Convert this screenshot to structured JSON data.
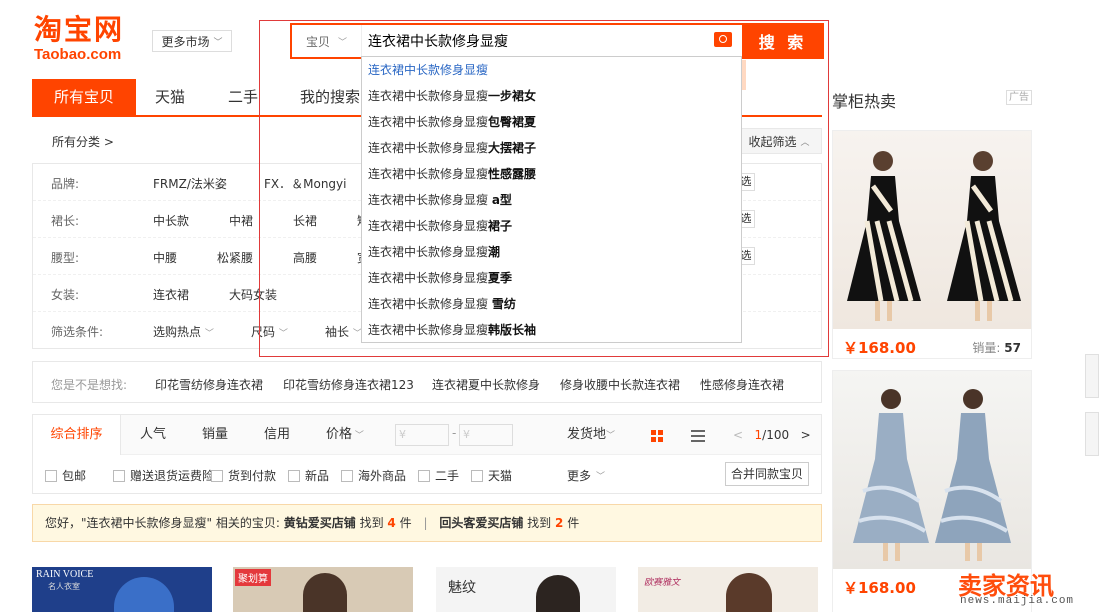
{
  "header": {
    "logo_cn": "淘宝网",
    "logo_en": "Taobao.com",
    "market": "更多市场"
  },
  "search": {
    "type": "宝贝",
    "value": "连衣裙中长款修身显瘦",
    "button": "搜 索"
  },
  "suggestions": [
    {
      "base": "连衣裙中长款修身显瘦",
      "extra": ""
    },
    {
      "base": "连衣裙中长款修身显瘦",
      "extra": "一步裙女"
    },
    {
      "base": "连衣裙中长款修身显瘦",
      "extra": "包臀裙夏"
    },
    {
      "base": "连衣裙中长款修身显瘦",
      "extra": "大摆裙子"
    },
    {
      "base": "连衣裙中长款修身显瘦",
      "extra": "性感露腰"
    },
    {
      "base": "连衣裙中长款修身显瘦 ",
      "extra": "a型"
    },
    {
      "base": "连衣裙中长款修身显瘦",
      "extra": "裙子"
    },
    {
      "base": "连衣裙中长款修身显瘦",
      "extra": "潮"
    },
    {
      "base": "连衣裙中长款修身显瘦",
      "extra": "夏季"
    },
    {
      "base": "连衣裙中长款修身显瘦 ",
      "extra": "雪纺"
    },
    {
      "base": "连衣裙中长款修身显瘦",
      "extra": "韩版长袖"
    }
  ],
  "tabs": [
    "所有宝贝",
    "天猫",
    "二手",
    "我的搜索"
  ],
  "filters": {
    "crumb": "所有分类 >",
    "collapse": "收起筛选",
    "multi": "选",
    "rows": [
      {
        "label": "品牌:",
        "options": [
          "FRMZ/法米姿",
          "FX．＆Mongyi"
        ]
      },
      {
        "label": "裙长:",
        "options": [
          "中长款",
          "中裙",
          "长裙",
          "短"
        ]
      },
      {
        "label": "腰型:",
        "options": [
          "中腰",
          "松紧腰",
          "高腰",
          "宽"
        ]
      },
      {
        "label": "女装:",
        "options": [
          "连衣裙",
          "大码女装"
        ]
      },
      {
        "label": "筛选条件:",
        "options": [
          "选购热点",
          "尺码",
          "袖长"
        ]
      }
    ]
  },
  "suggest_row": {
    "label": "您是不是想找:",
    "items": [
      "印花雪纺修身连衣裙",
      "印花雪纺修身连衣裙123",
      "连衣裙夏中长款修身",
      "修身收腰中长款连衣裙",
      "性感修身连衣裙"
    ]
  },
  "sort": {
    "items": [
      "综合排序",
      "人气",
      "销量",
      "信用",
      "价格"
    ],
    "price_from": "¥",
    "price_to": "¥",
    "ship_from": "发货地",
    "page_current": "1",
    "page_total": "/100"
  },
  "checks": [
    "包邮",
    "赠送退货运费险",
    "货到付款",
    "新品",
    "海外商品",
    "二手",
    "天猫"
  ],
  "more": "更多",
  "merge": "合并同款宝贝",
  "notice": {
    "prefix": "您好，\"连衣裙中长款修身显瘦\" 相关的宝贝:",
    "shop1": "黄钻爱买店铺",
    "found1": "找到",
    "count1": "4",
    "unit1": "件",
    "shop2": "回头客爱买店铺",
    "found2": "找到",
    "count2": "2",
    "unit2": "件"
  },
  "thumbs": [
    {
      "text": "RAIN VOICE",
      "sub": "名人衣室",
      "bg": "#2a5fb0"
    },
    {
      "text": "聚划算",
      "sub": "",
      "bg": "#c8b8a0"
    },
    {
      "text": "魅纹",
      "sub": "",
      "bg": "#ffffff"
    },
    {
      "text": "欧赛雅文",
      "sub": "",
      "bg": "#f4efe8"
    }
  ],
  "right": {
    "title": "掌柜热卖",
    "ad": "广告",
    "cards": [
      {
        "price": "￥168.00",
        "sales_label": "销量:",
        "sales": "57"
      },
      {
        "price": "￥168.00",
        "sales_label": "",
        "sales": ""
      }
    ]
  },
  "watermark": {
    "text": "卖家资讯",
    "url": "news.maijia.com"
  },
  "colors": {
    "accent": "#ff4400",
    "link": "#2a67c4"
  }
}
